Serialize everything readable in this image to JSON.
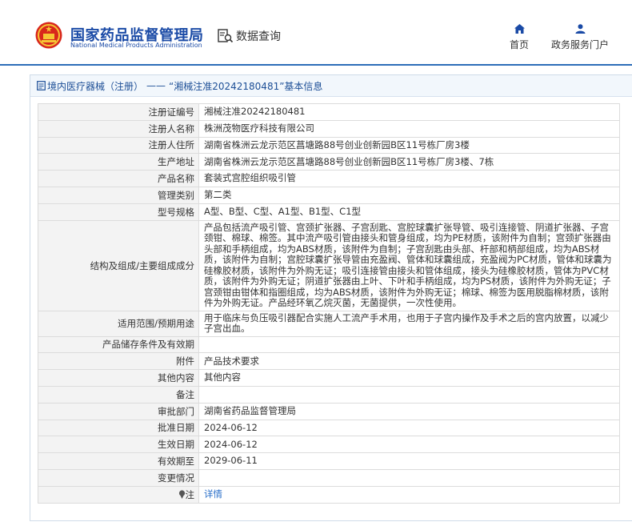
{
  "header": {
    "brand_cn": "国家药品监督管理局",
    "brand_en": "National Medical Products Administration",
    "data_query": "数据查询",
    "nav": [
      {
        "label": "首页",
        "icon": "home-icon"
      },
      {
        "label": "政务服务门户",
        "icon": "user-icon"
      }
    ],
    "accent_color": "#1a4aa6"
  },
  "breadcrumb": {
    "category": "境内医疗器械（注册）",
    "separator": "——",
    "current": "“湘械注准20242180481”基本信息"
  },
  "rows": [
    {
      "label": "注册证编号",
      "value": "湘械注准20242180481"
    },
    {
      "label": "注册人名称",
      "value": "株洲茂物医疗科技有限公司"
    },
    {
      "label": "注册人住所",
      "value": "湖南省株洲云龙示范区菖塘路88号创业创新园B区11号栋厂房3楼"
    },
    {
      "label": "生产地址",
      "value": "湖南省株洲云龙示范区菖塘路88号创业创新园B区11号栋厂房3楼、7栋"
    },
    {
      "label": "产品名称",
      "value": "套装式宫腔组织吸引管"
    },
    {
      "label": "管理类别",
      "value": "第二类"
    },
    {
      "label": "型号规格",
      "value": "A型、B型、C型、A1型、B1型、C1型"
    },
    {
      "label": "结构及组成/主要组成成分",
      "value": "产品包括流产吸引管、宫颈扩张器、子宫刮匙、宫腔球囊扩张导管、吸引连接管、阴道扩张器、子宫颈钳、棉球、棉签。其中流产吸引管由接头和管身组成，均为PE材质，该附件为自制；宫颈扩张器由头部和手柄组成，均为ABS材质，该附件为自制；子宫刮匙由头部、杆部和柄部组成，均为ABS材质，该附件为自制；宫腔球囊扩张导管由充盈阀、管体和球囊组成，充盈阀为PC材质，管体和球囊为硅橡胶材质，该附件为外购无证；吸引连接管由接头和管体组成，接头为硅橡胶材质，管体为PVC材质，该附件为外购无证；阴道扩张器由上叶、下叶和手柄组成，均为PS材质，该附件为外购无证；子宫颈钳由钳体和指圈组成，均为ABS材质，该附件为外购无证；棉球、棉签为医用脱脂棉材质，该附件为外购无证。产品经环氧乙烷灭菌，无菌提供，一次性使用。"
    },
    {
      "label": "适用范围/预期用途",
      "value": "用于临床与负压吸引器配合实施人工流产手术用，也用于子宫内操作及手术之后的宫内放置，以减少子宫出血。"
    },
    {
      "label": "产品储存条件及有效期",
      "value": ""
    },
    {
      "label": "附件",
      "value": "产品技术要求"
    },
    {
      "label": "其他内容",
      "value": "其他内容"
    },
    {
      "label": "备注",
      "value": ""
    },
    {
      "label": "审批部门",
      "value": "湖南省药品监督管理局"
    },
    {
      "label": "批准日期",
      "value": "2024-06-12"
    },
    {
      "label": "生效日期",
      "value": "2024-06-12"
    },
    {
      "label": "有效期至",
      "value": "2029-06-11"
    },
    {
      "label": "变更情况",
      "value": ""
    }
  ],
  "note": {
    "label": "注",
    "icon": "pin-icon",
    "link": "详情"
  }
}
